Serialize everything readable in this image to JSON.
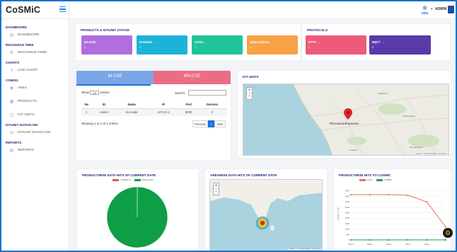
{
  "brand": "CoSMiC",
  "header": {
    "admin_label": "ADMIN"
  },
  "sidebar": {
    "sections": [
      {
        "title": "DASHBOARD",
        "items": [
          {
            "label": "DASHBOARD",
            "icon": "dashboard-icon"
          }
        ]
      },
      {
        "title": "RESOURCE TREE",
        "items": [
          {
            "label": "RESOURCE TREE",
            "icon": "tree-icon"
          }
        ]
      },
      {
        "title": "CHARTS",
        "items": [
          {
            "label": "LIVE CHART",
            "icon": "line-chart-icon"
          }
        ]
      },
      {
        "title": "CONFIG",
        "items": [
          {
            "label": "AREA",
            "icon": "location-pin-icon"
          },
          {
            "label": "PRODUCTS",
            "icon": "products-icon"
          },
          {
            "label": "IOT UNITS",
            "icon": "iot-unit-icon"
          }
        ]
      },
      {
        "title": "IOTUNIT DATAFLOW",
        "items": [
          {
            "label": "IOTUNIT DATAFLOW",
            "icon": "dataflow-icon"
          }
        ]
      },
      {
        "title": "REPORTS",
        "items": [
          {
            "label": "REPORTS",
            "icon": "report-icon"
          }
        ]
      }
    ]
  },
  "status": {
    "title": "PRODUCTS & IOTUNIT STATUS",
    "tiles": [
      {
        "label": "Iot Units",
        "value": "1",
        "color": "#b06fdc"
      },
      {
        "label": "Products",
        "value": "1",
        "color": "#1cb3d8"
      },
      {
        "label": "Active",
        "value": "1",
        "color": "#1fc49a"
      },
      {
        "label": "Subscriptions",
        "value": "1",
        "color": "#f6a245"
      }
    ]
  },
  "protocols": {
    "title": "PROTOCOLS",
    "tiles": [
      {
        "label": "HTTP",
        "value": "1",
        "color": "#ee5a7a"
      },
      {
        "label": "MQTT",
        "value": "0",
        "color": "#5a3aa8"
      }
    ]
  },
  "cse": {
    "tabs": [
      {
        "label": "IN-CSE",
        "value": "1"
      },
      {
        "label": "MN-CSE",
        "value": "1"
      }
    ],
    "show_label": "Show",
    "entries_label": "entries",
    "page_size": "10",
    "search_label": "Search:",
    "columns": [
      "No",
      "ID",
      "Name",
      "IP",
      "Port",
      "Devices"
    ],
    "rows": [
      [
        "1",
        "cosmic",
        "mn-node",
        "127.0.0.1",
        "8000",
        "0"
      ]
    ],
    "info": "Showing 1 to 1 of 1 entries",
    "prev_label": "Previous",
    "page_current": "1",
    "next_label": "Next"
  },
  "iot_units": {
    "title": "IOT UNITS",
    "city_label": "Thiruvananthapuram",
    "attribution": "Leaflet | © OpenStreetMap contributors"
  },
  "product_hits": {
    "title": "PRODUCTWISE DATA HITS OF CURRENT DATE",
    "legend": [
      "TTHERM (1)",
      "Testing (1787)"
    ]
  },
  "area_hits": {
    "title": "AREAWISE DATA HITS OF CURRENT DATE",
    "attribution": "Leaflet | © OpenStreetMap contributors"
  },
  "cosmic_hits": {
    "title": "PRODUCTWISE HITS TO COSMIC",
    "legend": [
      "testnet",
      "TTHERM"
    ]
  },
  "chart_data": [
    {
      "type": "pie",
      "title": "PRODUCTWISE DATA HITS OF CURRENT DATE",
      "labels": [
        "TTHERM (1)",
        "Testing (1787)"
      ],
      "values": [
        1,
        1787
      ],
      "colors": [
        "#e2554d",
        "#0e9e46"
      ]
    },
    {
      "type": "line",
      "title": "PRODUCTWISE HITS TO COSMIC",
      "ylabel": "Number of hits",
      "x": [
        "07Dec",
        "08Dec",
        "09Dec",
        "10Dec",
        "11Dec"
      ],
      "yticks": [
        0,
        500,
        1000,
        1500,
        2000,
        2500,
        3000,
        3500,
        4000,
        4500
      ],
      "ylim": [
        0,
        4800
      ],
      "series": [
        {
          "name": "testnet",
          "color": "#e9705a",
          "values": [
            4150,
            4150,
            4150,
            4100,
            3500,
            1200
          ]
        },
        {
          "name": "TTHERM",
          "color": "#21a350",
          "values": [
            10,
            10,
            10,
            10,
            10,
            10
          ]
        }
      ],
      "x_positions": [
        0,
        1,
        2,
        3,
        4,
        5
      ]
    }
  ]
}
